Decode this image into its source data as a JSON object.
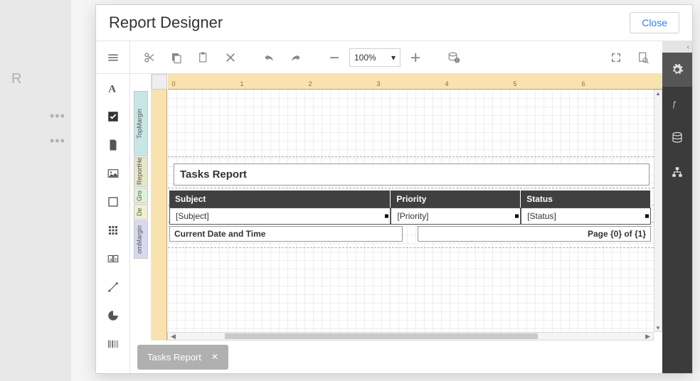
{
  "dialog": {
    "title": "Report Designer",
    "close_label": "Close"
  },
  "toolbar": {
    "zoom_level": "100%"
  },
  "ruler": {
    "ticks": [
      "0",
      "1",
      "2",
      "3",
      "4",
      "5",
      "6"
    ]
  },
  "bands": {
    "top_margin": "TopMargin",
    "report_header": "ReportHe",
    "group": "Gro",
    "detail": "De",
    "bottom_margin": "omMargin"
  },
  "design": {
    "title_text": "Tasks Report",
    "columns": {
      "subject": "Subject",
      "priority": "Priority",
      "status": "Status"
    },
    "fields": {
      "subject": "[Subject]",
      "priority": "[Priority]",
      "status": "[Status]"
    },
    "footer": {
      "date": "Current Date and Time",
      "page": "Page {0} of {1}"
    }
  },
  "tab": {
    "label": "Tasks Report"
  },
  "right_rail": {
    "items": [
      "settings",
      "fx",
      "database",
      "hierarchy"
    ]
  }
}
